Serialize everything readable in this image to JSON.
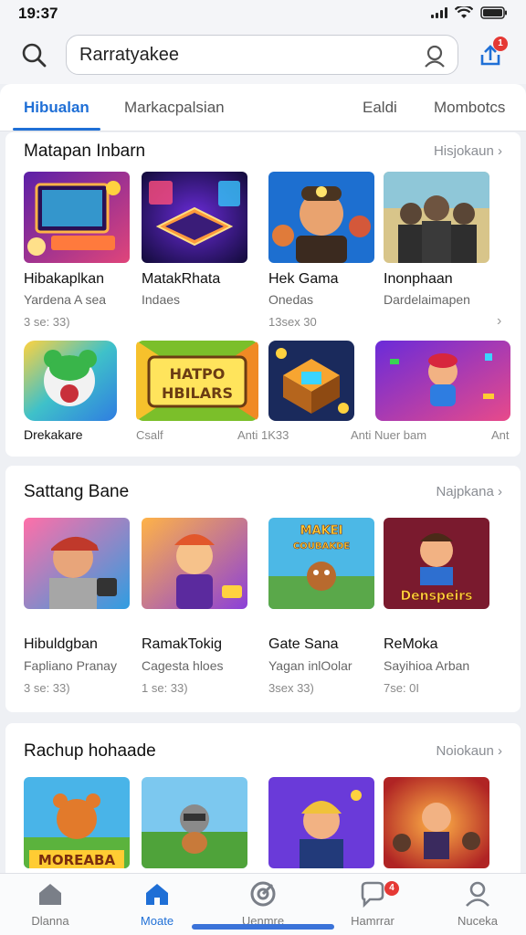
{
  "status": {
    "time": "19:37"
  },
  "search": {
    "value": "Rarratyakee"
  },
  "header": {
    "badge": "1"
  },
  "tabs": [
    {
      "label": "Hibualan",
      "active": true
    },
    {
      "label": "Markacpalsian",
      "active": false
    },
    {
      "label": "Ealdi",
      "active": false
    },
    {
      "label": "Mombotcs",
      "active": false
    }
  ],
  "sections": [
    {
      "title": "Matapan Inbarn",
      "more": "Hisjokaun",
      "row1": [
        {
          "name": "Hibakaplkan",
          "sub": "Yardena A sea",
          "meta": "3 se: 33)",
          "icon": "retro-computer-art"
        },
        {
          "name": "MatakRhata",
          "sub": "Indaes",
          "meta": "",
          "icon": "glowing-tablet-art"
        },
        {
          "name": "Hek Gama",
          "sub": "Onedas",
          "meta": "13sex 30",
          "icon": "miner-hero-art"
        },
        {
          "name": "Inonphaan",
          "sub": "Dardelaimapen",
          "meta": "",
          "icon": "soldier-squad-art"
        }
      ],
      "row2": [
        {
          "name": "Drekakare",
          "icon": "green-bear-art"
        },
        {
          "name": "Csalf",
          "icon": "hbilars-banner-art",
          "banner": "HATPO HBILARS"
        },
        {
          "name": "Anti 1K33",
          "icon": "treasure-box-art"
        },
        {
          "name": "Anti Nuer bam",
          "icon": "flying-hero-art"
        },
        {
          "name": "Ant",
          "icon": ""
        }
      ]
    },
    {
      "title": "Sattang Bane",
      "more": "Najpkana",
      "row1": [
        {
          "name": "Hibuldgban",
          "sub": "Fapliano Pranay",
          "meta": "3 se: 33)",
          "icon": "cap-guy-art"
        },
        {
          "name": "RamakTokig",
          "sub": "Cagesta hloes",
          "meta": "1 se: 33)",
          "icon": "kid-cape-art"
        },
        {
          "name": "Gate Sana",
          "sub": "Yagan inlOolar",
          "meta": "3sex 33)",
          "icon": "makei-creature-art",
          "banner": "MAKEI COUBAKDE"
        },
        {
          "name": "ReMoka",
          "sub": "Sayihioa Arban",
          "meta": "7se: 0I",
          "icon": "denspeirs-hero-art",
          "banner": "Denspeirs"
        }
      ]
    },
    {
      "title": "Rachup hohaade",
      "more": "Noiokaun",
      "row1": [
        {
          "name": "",
          "icon": "orange-bear-art",
          "banner": "MOREABA"
        },
        {
          "name": "",
          "icon": "raccoon-field-art"
        },
        {
          "name": "",
          "icon": "helmet-guy-art"
        },
        {
          "name": "",
          "icon": "action-fight-art"
        }
      ]
    }
  ],
  "nav": [
    {
      "label": "Dlanna",
      "icon": "home-icon",
      "active": false
    },
    {
      "label": "Moate",
      "icon": "home-filled-icon",
      "active": true
    },
    {
      "label": "Uenmre",
      "icon": "target-icon",
      "active": false
    },
    {
      "label": "Hamrrar",
      "icon": "chat-icon",
      "active": false,
      "badge": "4"
    },
    {
      "label": "Nuceka",
      "icon": "profile-icon",
      "active": false
    }
  ],
  "colors": {
    "accent": "#1f6fd6",
    "badge": "#e53935"
  }
}
